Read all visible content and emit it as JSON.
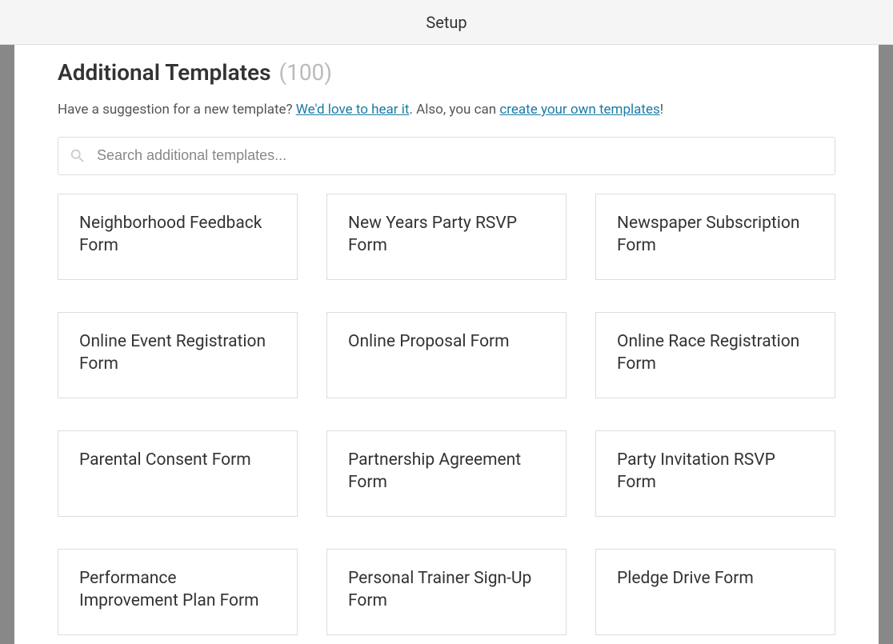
{
  "header": {
    "title": "Setup"
  },
  "page": {
    "heading": "Additional Templates",
    "count": "(100)",
    "subtitle_prefix": "Have a suggestion for a new template? ",
    "subtitle_link1": "We'd love to hear it",
    "subtitle_mid": ". Also, you can ",
    "subtitle_link2": "create your own templates",
    "subtitle_suffix": "!"
  },
  "search": {
    "placeholder": "Search additional templates..."
  },
  "templates": [
    {
      "name": "Neighborhood Feedback Form"
    },
    {
      "name": "New Years Party RSVP Form"
    },
    {
      "name": "Newspaper Subscription Form"
    },
    {
      "name": "Online Event Registration Form"
    },
    {
      "name": "Online Proposal Form"
    },
    {
      "name": "Online Race Registration Form"
    },
    {
      "name": "Parental Consent Form"
    },
    {
      "name": "Partnership Agreement Form"
    },
    {
      "name": "Party Invitation RSVP Form"
    },
    {
      "name": "Performance Improvement Plan Form"
    },
    {
      "name": "Personal Trainer Sign-Up Form"
    },
    {
      "name": "Pledge Drive Form"
    }
  ]
}
